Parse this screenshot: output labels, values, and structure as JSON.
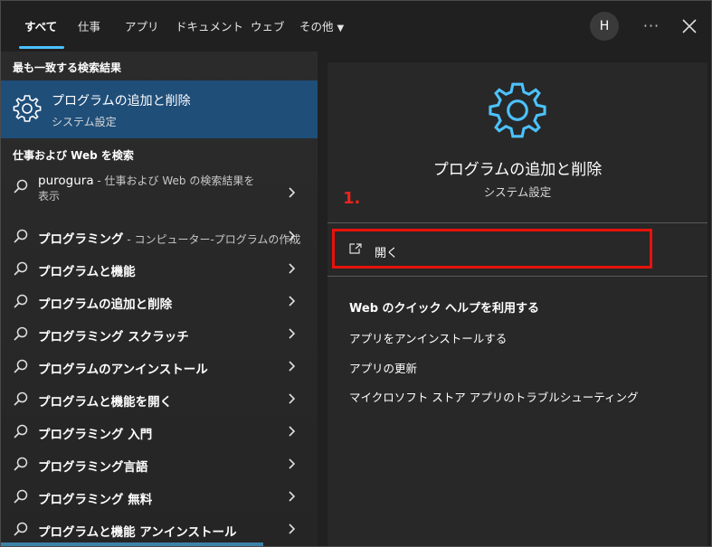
{
  "tabs": [
    {
      "label": "すべて"
    },
    {
      "label": "仕事"
    },
    {
      "label": "アプリ"
    },
    {
      "label": "ドキュメント"
    },
    {
      "label": "ウェブ"
    },
    {
      "label": "その他"
    }
  ],
  "header": {
    "avatar_letter": "H",
    "more_label": "···"
  },
  "left": {
    "best_match_label": "最も一致する検索結果",
    "best_match": {
      "title": "プログラムの追加と削除",
      "subtitle": "システム設定",
      "icon": "gear-icon"
    },
    "web_search_label": "仕事および Web を検索",
    "results": [
      {
        "text": "purogura",
        "sub": " - 仕事および Web の検索結果を",
        "sub2": "表示"
      },
      {
        "text": "プログラミング",
        "sub": " - コンピューター-プログラムの作成"
      },
      {
        "text": "プログラムと機能",
        "sub": ""
      },
      {
        "text": "プログラムの追加と削除",
        "sub": ""
      },
      {
        "text": "プログラミング スクラッチ",
        "sub": ""
      },
      {
        "text": "プログラムのアンインストール",
        "sub": ""
      },
      {
        "text": "プログラムと機能を開く",
        "sub": ""
      },
      {
        "text": "プログラミング 入門",
        "sub": ""
      },
      {
        "text": "プログラミング言語",
        "sub": ""
      },
      {
        "text": "プログラミング 無料",
        "sub": ""
      },
      {
        "text": "プログラムと機能 アンインストール",
        "sub": ""
      }
    ]
  },
  "right": {
    "title": "プログラムの追加と削除",
    "subtitle": "システム設定",
    "step_marker": "1.",
    "open_label": "開く",
    "help_title": "Web のクイック ヘルプを利用する",
    "help_links": [
      "アプリをアンインストールする",
      "アプリの更新",
      "マイクロソフト ストア アプリのトラブルシューティング"
    ]
  },
  "colors": {
    "accent": "#4cc2ff",
    "selected": "#1f4e79",
    "highlight": "#e8120c",
    "step": "#e8241d"
  }
}
